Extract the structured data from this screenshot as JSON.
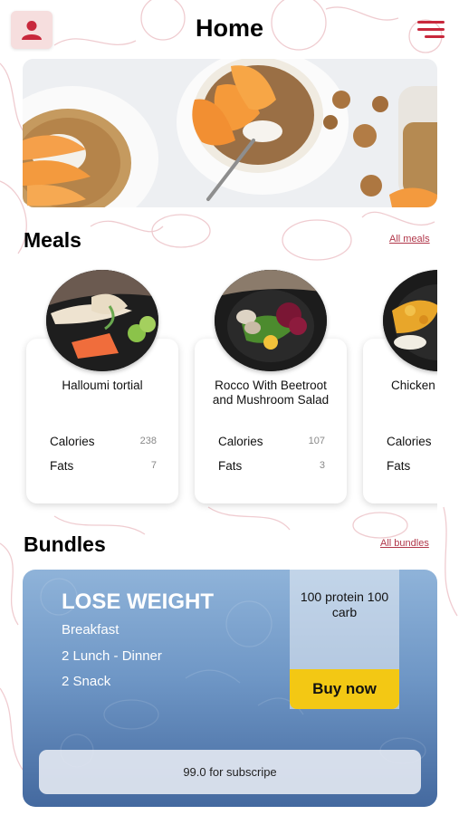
{
  "header": {
    "title": "Home",
    "profile_icon": "user-icon",
    "menu_icon": "menu-icon"
  },
  "colors": {
    "accent": "#c8283c",
    "profile_bg": "#f6dede",
    "buy": "#f3c814",
    "link": "#b1374a"
  },
  "meals": {
    "title": "Meals",
    "see_all": "All meals",
    "items": [
      {
        "name": "Halloumi tortial",
        "calories_label": "Calories",
        "calories": "238",
        "fats_label": "Fats",
        "fats": "7"
      },
      {
        "name": "Rocco With Beetroot and Mushroom Salad",
        "calories_label": "Calories",
        "calories": "107",
        "fats_label": "Fats",
        "fats": "3"
      },
      {
        "name": "Chicken",
        "calories_label": "Calories",
        "calories": "",
        "fats_label": "Fats",
        "fats": ""
      }
    ]
  },
  "bundles": {
    "title": "Bundles",
    "see_all": "All bundles",
    "card": {
      "title": "LOSE WEIGHT",
      "items": [
        "Breakfast",
        "2 Lunch - Dinner",
        "2 Snack"
      ],
      "macros": "100 protein 100 carb",
      "buy_label": "Buy now",
      "subscribe": "99.0 for subscripe"
    }
  }
}
